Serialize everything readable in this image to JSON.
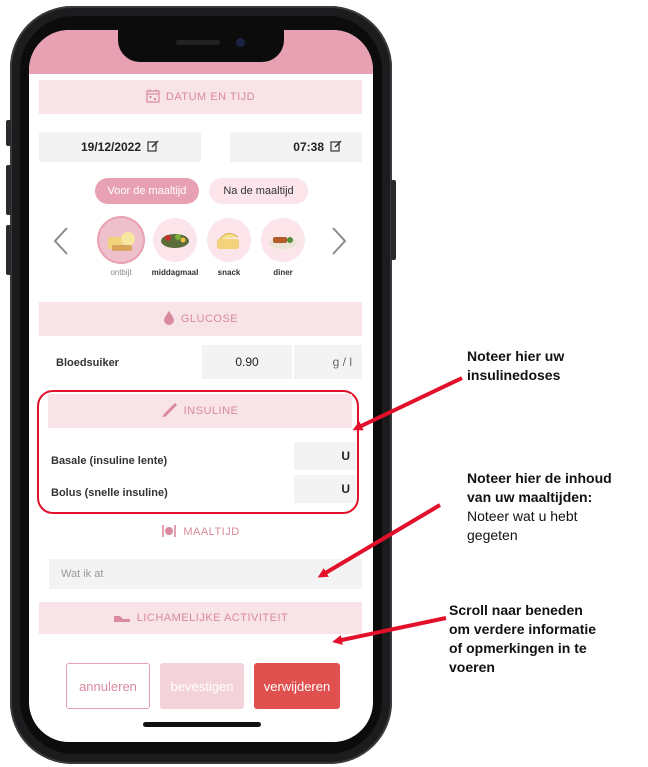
{
  "header_datetime": {
    "label": "DATUM EN TIJD",
    "icon": "calendar-icon"
  },
  "date": {
    "value": "19/12/2022"
  },
  "time": {
    "value": "07:38"
  },
  "meal_timing": {
    "before": "Voor de maaltijd",
    "after": "Na de maaltijd"
  },
  "meals": [
    {
      "label": "ontbijt"
    },
    {
      "label": "middagmaal"
    },
    {
      "label": "snack"
    },
    {
      "label": "diner"
    }
  ],
  "glucose": {
    "header": "GLUCOSE",
    "label": "Bloedsuiker",
    "value": "0.90",
    "unit": "g / l"
  },
  "insulin": {
    "header": "INSULINE",
    "basal_label": "Basale (insuline lente)",
    "basal_unit": "U",
    "bolus_label": "Bolus (snelle insuline)",
    "bolus_unit": "U"
  },
  "meal": {
    "header": "MAALTIJD",
    "placeholder": "Wat ik at"
  },
  "activity": {
    "header": "LICHAMELIJKE ACTIVITEIT"
  },
  "buttons": {
    "cancel": "annuleren",
    "confirm": "bevestigen",
    "delete": "verwijderen"
  },
  "annotations": {
    "insulin_line1": "Noteer hier uw",
    "insulin_line2": "insulinedoses",
    "meal_line1": "Noteer hier de inhoud",
    "meal_line2": "van uw maaltijden:",
    "meal_line3": "Noteer wat u hebt",
    "meal_line4": "gegeten",
    "scroll_line1": "Scroll naar beneden",
    "scroll_line2": "om verdere informatie",
    "scroll_line3": "of opmerkingen in te",
    "scroll_line4": "voeren"
  },
  "colors": {
    "accent_pink": "#e8a1b3",
    "section_bg": "#f8e3e8",
    "delete_red": "#e0504f",
    "highlight_red": "#e2102a"
  }
}
